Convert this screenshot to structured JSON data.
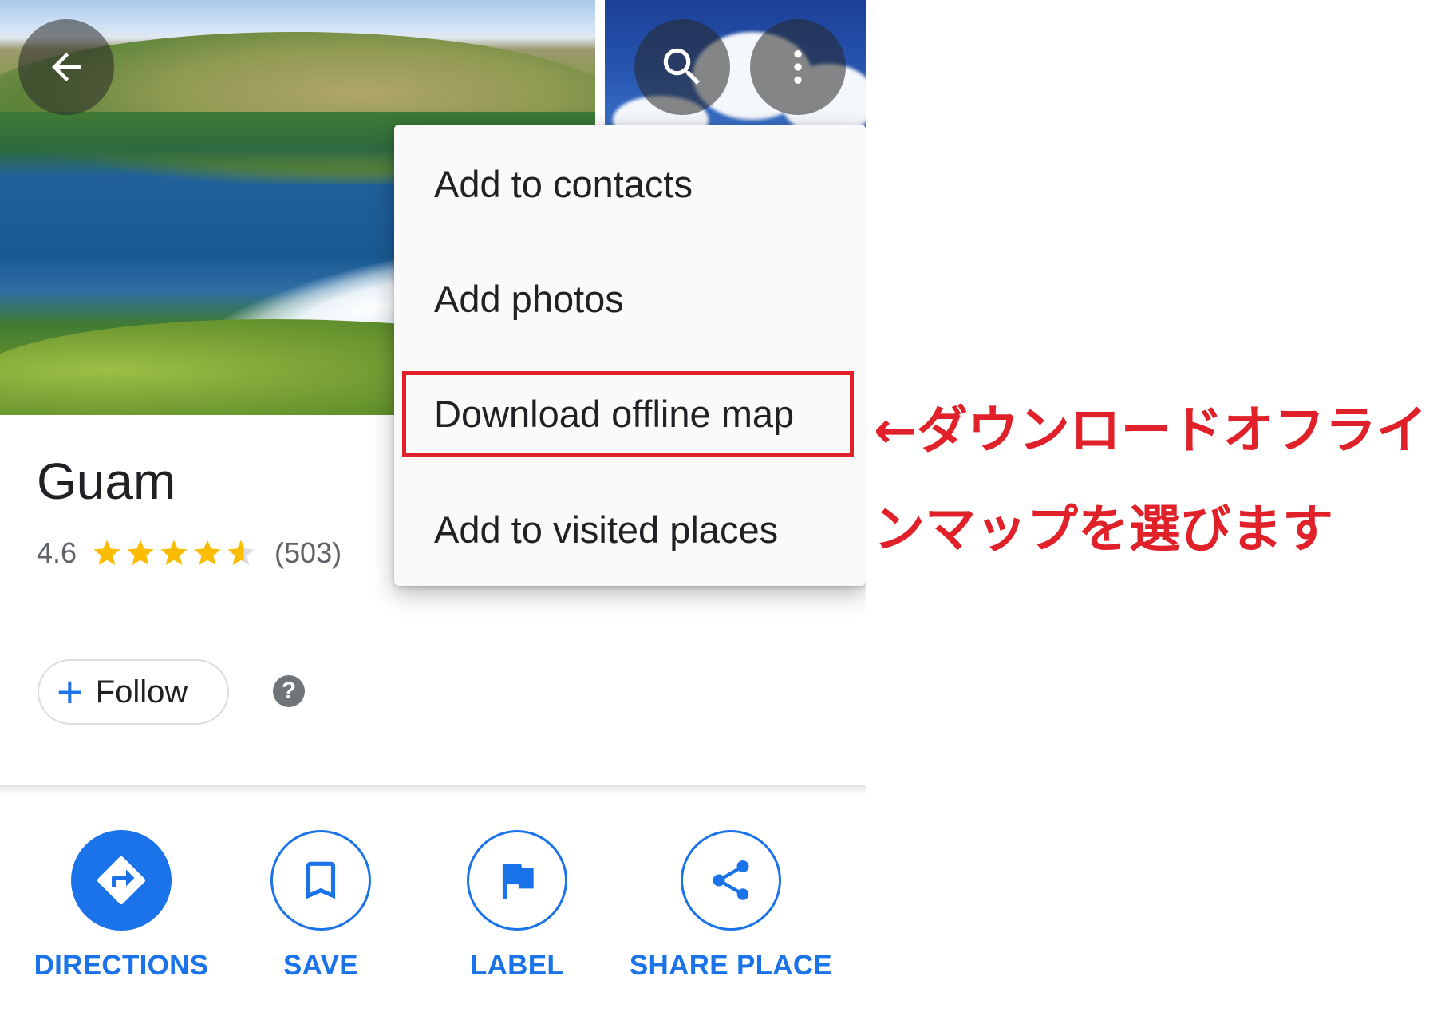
{
  "place": {
    "name": "Guam",
    "rating": "4.6",
    "rating_value": 4.6,
    "rating_max": 5,
    "review_count": "(503)"
  },
  "follow": {
    "label": "Follow"
  },
  "help": {
    "label": "?"
  },
  "header_icons": {
    "back": "arrow-left-icon",
    "search": "search-icon",
    "more": "more-vert-icon"
  },
  "menu": {
    "items": [
      {
        "label": "Add to contacts"
      },
      {
        "label": "Add photos"
      },
      {
        "label": "Download offline map"
      },
      {
        "label": "Add to visited places"
      }
    ]
  },
  "actions": [
    {
      "label": "DIRECTIONS",
      "icon": "directions-icon"
    },
    {
      "label": "SAVE",
      "icon": "bookmark-icon"
    },
    {
      "label": "LABEL",
      "icon": "flag-icon"
    },
    {
      "label": "SHARE PLACE",
      "icon": "share-icon"
    }
  ],
  "annotation": {
    "text": "←ダウンロードオフラインマップを選びます"
  },
  "colors": {
    "accent": "#1a73e8",
    "star": "#fbbc04",
    "annotation": "#e0212a"
  }
}
